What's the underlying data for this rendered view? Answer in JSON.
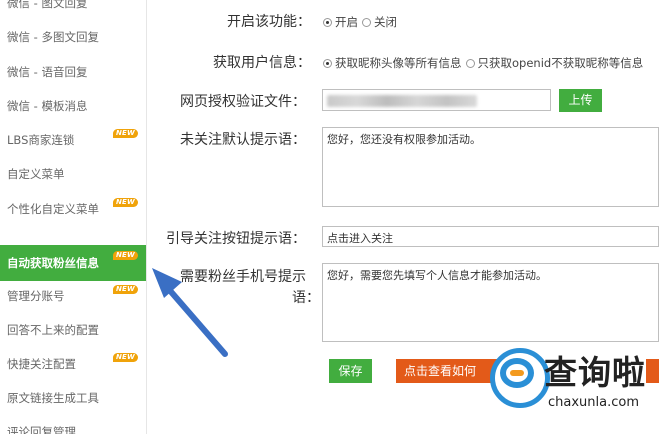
{
  "sidebar": {
    "items": [
      {
        "label": "微信 - 图文回复",
        "new": false,
        "active": false
      },
      {
        "label": "微信 - 多图文回复",
        "new": false,
        "active": false
      },
      {
        "label": "微信 - 语音回复",
        "new": false,
        "active": false
      },
      {
        "label": "微信 - 模板消息",
        "new": false,
        "active": false
      },
      {
        "label": "LBS商家连锁",
        "new": true,
        "active": false
      },
      {
        "label": "自定义菜单",
        "new": false,
        "active": false
      },
      {
        "label": "个性化自定义菜单",
        "new": true,
        "active": false
      },
      {
        "label": "自动获取粉丝信息",
        "new": true,
        "active": true
      },
      {
        "label": "管理分账号",
        "new": true,
        "active": false
      },
      {
        "label": "回答不上来的配置",
        "new": false,
        "active": false
      },
      {
        "label": "快捷关注配置",
        "new": true,
        "active": false
      },
      {
        "label": "原文链接生成工具",
        "new": false,
        "active": false
      },
      {
        "label": "评论回复管理",
        "new": false,
        "active": false
      }
    ],
    "new_badge": "NEW"
  },
  "form": {
    "enable": {
      "label": "开启该功能：",
      "options": [
        "开启",
        "关闭"
      ],
      "selected": "开启"
    },
    "user_info": {
      "label": "获取用户信息：",
      "options": [
        "获取昵称头像等所有信息",
        "只获取openid不获取昵称等信息"
      ],
      "selected": "获取昵称头像等所有信息"
    },
    "auth_file": {
      "label": "网页授权验证文件：",
      "upload_label": "上传"
    },
    "default_tip": {
      "label": "未关注默认提示语：",
      "value": "您好，您还没有权限参加活动。"
    },
    "follow_button": {
      "label": "引导关注按钮提示语：",
      "value": "点击进入关注"
    },
    "phone_tip": {
      "label_line1": "需要粉丝手机号提示",
      "label_line2": "语：",
      "value": "您好，需要您先填写个人信息才能参加活动。"
    },
    "save_label": "保存",
    "preview_label": "点击查看如何"
  },
  "watermark": {
    "brand": "查询啦",
    "domain": "chaxunla.com"
  },
  "colors": {
    "accent_green": "#42ad3f",
    "orange": "#e35a19",
    "badge": "#f0a30a",
    "arrow_blue": "#3a6fc4"
  }
}
